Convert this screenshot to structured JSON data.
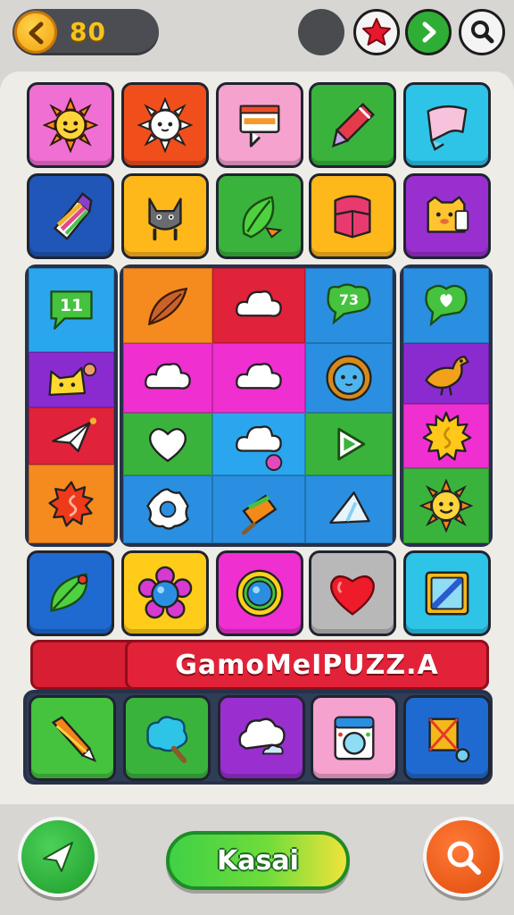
{
  "topbar": {
    "coins": "80",
    "icons": [
      "back-arrow-icon",
      "star-icon",
      "next-arrow-icon",
      "search-icon"
    ]
  },
  "board": {
    "top_rows": [
      [
        "sun-icon",
        "sun-face-icon",
        "note-icon",
        "pencil-icon",
        "cloth-icon"
      ],
      [
        "candy-icon",
        "cat-icon",
        "leaf-icon",
        "book-icon",
        "bear-icon"
      ]
    ],
    "left_column": [
      "chat-bubble-icon",
      "yellow-cat-icon",
      "paper-plane-icon",
      "swirl-sun-icon"
    ],
    "left_column_text": "11",
    "center_grid": [
      [
        "feather-icon",
        "cloud-icon",
        "chat-bubble-icon"
      ],
      [
        "cloud-icon",
        "cloud-icon",
        "lion-icon"
      ],
      [
        "heart-outline-icon",
        "cloud-icon",
        "play-icon"
      ],
      [
        "flower-icon",
        "popsicle-icon",
        "shard-icon"
      ]
    ],
    "center_grid_text": "73",
    "right_column": [
      "heart-bubble-icon",
      "bird-icon",
      "sun-icon",
      "sun-face-icon"
    ],
    "bottom_rows": [
      [
        "leaf-icon",
        "flower-icon",
        "ring-icon",
        "heart-icon",
        "ruler-icon"
      ],
      [
        "pencil-icon",
        "tree-icon",
        "cloud-icon",
        "washer-icon",
        "kite-icon"
      ]
    ]
  },
  "banner": {
    "title": "GamoMeIPUZZ.A"
  },
  "bottombar": {
    "play_label": "Kasai",
    "left_icon": "send-icon",
    "right_icon": "zoom-icon"
  },
  "colors": {
    "background": "#d7d6d2",
    "board": "#eeece6",
    "banner": "#e22238",
    "play_button": "#3fd146",
    "coin": "#f7c21c"
  }
}
